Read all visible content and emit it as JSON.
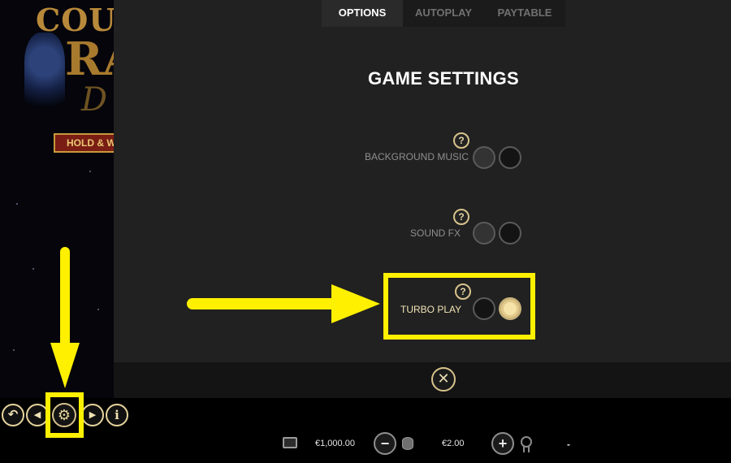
{
  "game_logo": {
    "text_top": "COU",
    "text_mid": "RA",
    "text_script": "D",
    "banner": "HOLD & W"
  },
  "tabs": [
    {
      "label": "OPTIONS",
      "active": true
    },
    {
      "label": "AUTOPLAY",
      "active": false
    },
    {
      "label": "PAYTABLE",
      "active": false
    }
  ],
  "settings": {
    "title": "GAME SETTINGS",
    "items": [
      {
        "label": "BACKGROUND MUSIC",
        "help": "?",
        "state": "off"
      },
      {
        "label": "SOUND FX",
        "help": "?",
        "state": "off"
      },
      {
        "label": "TURBO PLAY",
        "help": "?",
        "state": "on"
      }
    ],
    "close_symbol": "✕"
  },
  "controls": {
    "back_symbol": "↶",
    "prev_symbol": "◀",
    "settings_symbol": "⚙",
    "next_symbol": "▶",
    "info_symbol": "i",
    "minus_symbol": "−",
    "plus_symbol": "+"
  },
  "wallet": {
    "balance": "€1,000.00",
    "bet": "€2.00",
    "win": "-"
  },
  "colors": {
    "accent_gold": "#d8c38c",
    "panel_bg": "#212121",
    "highlight_yellow": "#fff000"
  },
  "icons": [
    "help-icon",
    "close-icon",
    "gear-icon",
    "wallet-icon",
    "chip-stack-icon",
    "award-icon"
  ]
}
